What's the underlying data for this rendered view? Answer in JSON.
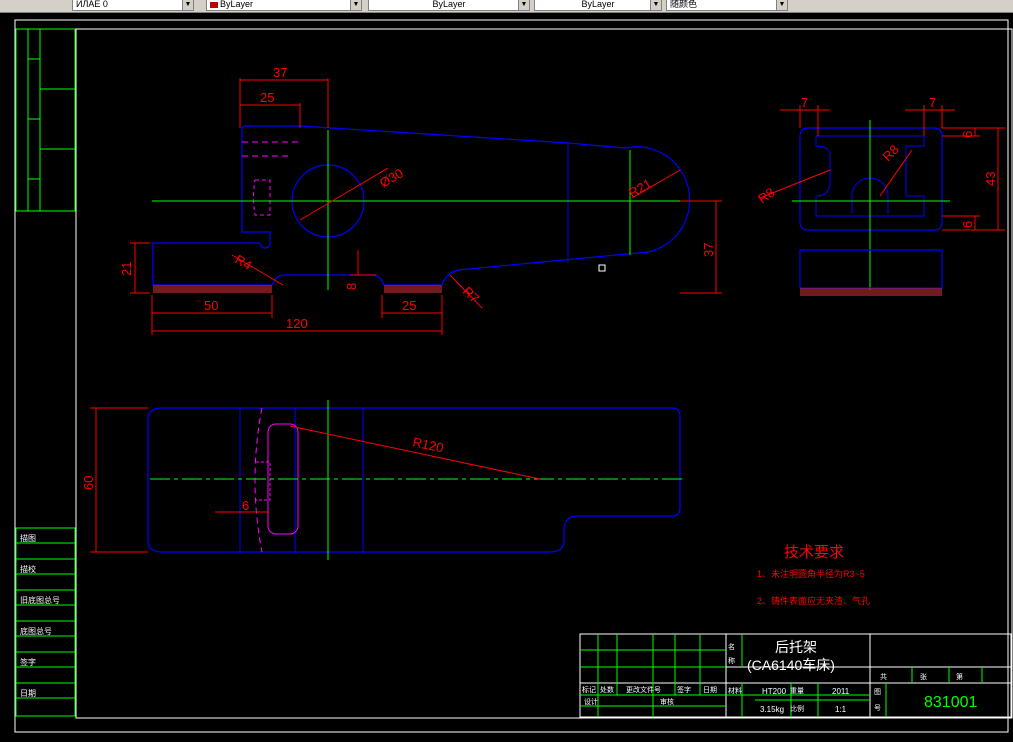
{
  "toolbar": {
    "layer_combo": "ИЛАЕ 0",
    "color_combo": "ByLayer",
    "linetype_combo": "ByLayer",
    "lineweight_combo": "ByLayer",
    "plotstyle_combo": "随颜色"
  },
  "dimensions": {
    "d37_top": "37",
    "d25_top": "25",
    "d30": "Ø30",
    "r21": "R21",
    "r4": "R4",
    "r7": "R7",
    "d21": "21",
    "d50": "50",
    "d120": "120",
    "d8": "8",
    "d25_bottom": "25",
    "d37_right": "37",
    "d7_left": "7",
    "d7_right": "7",
    "d6_top": "6",
    "d6_bottom": "6",
    "d43": "43",
    "r8_left": "R8",
    "r8_right": "R8",
    "d60": "60",
    "r120": "R120",
    "d6_small": "6"
  },
  "tech_requirements": {
    "title": "技术要求",
    "line1": "1、未注明圆角半径为R3~5",
    "line2": "2、铸件表面应无夹渣、气孔"
  },
  "title_block": {
    "part_name": "后托架",
    "machine": "(CA6140车床)",
    "material": "HT200",
    "weight": "3.15kg",
    "year": "2011",
    "scale": "1:1",
    "drawing_number": "831001",
    "label_weight": "重量",
    "label_scale": "比例",
    "label_sheet": "共",
    "label_page": "张",
    "label_no": "第",
    "label_mark": "标记",
    "label_count": "处数",
    "label_change_no": "更改文件号",
    "label_sign": "签字",
    "label_date": "日期",
    "label_design": "设计",
    "label_approve": "审核",
    "label_material": "材料",
    "label_part_name_a": "名",
    "label_part_name_b": "称",
    "label_drawing_no_a": "图",
    "label_drawing_no_b": "号"
  },
  "left_strip": {
    "label1": "描图",
    "label2": "描校",
    "label3": "旧底图总号",
    "label4": "底图总号",
    "label5": "签字",
    "label6": "日期"
  }
}
